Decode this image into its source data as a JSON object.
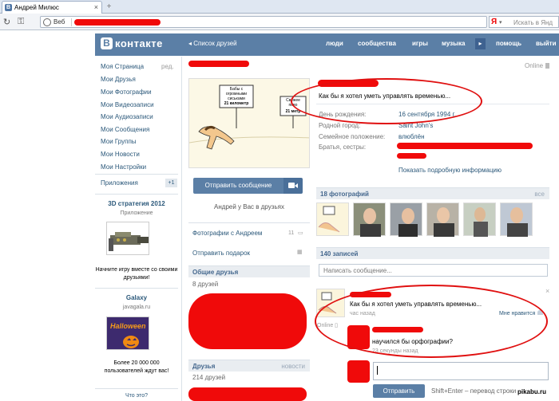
{
  "browser": {
    "tab_title": "Андрей Милюс",
    "tab_close": "×",
    "new_tab": "+",
    "address_label": "Веб",
    "search_placeholder": "Искать в Янд",
    "search_logo": "Я"
  },
  "header": {
    "logo_letter": "В",
    "logo_text": "контакте",
    "friends_list_link": "Список друзей",
    "nav": [
      "люди",
      "сообщества",
      "игры",
      "музыка",
      "помощь",
      "выйти"
    ],
    "brand_color": "#5b7fa6"
  },
  "left_menu": {
    "edit_label": "ред.",
    "items": [
      "Моя Страница",
      "Мои Друзья",
      "Мои Фотографии",
      "Мои Видеозаписи",
      "Мои Аудиозаписи",
      "Мои Сообщения",
      "Мои Группы",
      "Мои Новости",
      "Мои Настройки"
    ],
    "apps_label": "Приложения",
    "apps_count": "+1"
  },
  "ads": [
    {
      "title": "3D стратегия 2012",
      "subtitle": "Приложение",
      "text": "Начните игру вместе со своими друзьями!"
    },
    {
      "title": "Galaxy",
      "subtitle": "javagala.ru",
      "text": "Более 20 000 000 пользователей ждут вас!",
      "image_text": "Halloween"
    }
  ],
  "ads_footer": "Что это?",
  "profile": {
    "online_label": "Online",
    "status_text": "Как бы я хотел уметь управлять временью...",
    "fields": [
      {
        "label": "День рождения:",
        "value": "16 сентября 1994 г."
      },
      {
        "label": "Родной город:",
        "value": "Saint John's"
      },
      {
        "label": "Семейное положение:",
        "value": "влюблён"
      },
      {
        "label": "Братья, сестры:",
        "value": ""
      }
    ],
    "show_full": "Показать подробную информацию",
    "avatar_sign_1": "Бабы с огромными сиськами",
    "avatar_sign_1_km": "21 километр",
    "avatar_sign_2": "Свежее пиво",
    "avatar_sign_2_km": "21 метр"
  },
  "left_column": {
    "send_message": "Отправить сообщение",
    "in_friends": "Андрей у Вас в друзьях",
    "photos_with": "Фотографии с Андреем",
    "photos_with_count": "11",
    "send_gift": "Отправить подарок",
    "mutual_friends": "Общие друзья",
    "mutual_count": "8 друзей",
    "friends": "Друзья",
    "friends_new": "новости",
    "friends_count": "214 друзей"
  },
  "photos": {
    "header": "18 фотографий",
    "all": "все"
  },
  "wall": {
    "header": "140 записей",
    "input_placeholder": "Написать сообщение...",
    "post_text": "Как бы я хотел уметь управлять временью...",
    "post_time": "час назад",
    "like_label": "Мне нравится",
    "close": "×",
    "online_label": "Online",
    "comment_text": "научился бы орфографии?",
    "comment_time": "23 секунды назад",
    "send_button": "Отправить",
    "hint": "Shift+Enter – перевод строки",
    "watermark": "pikabu.ru"
  },
  "colors": {
    "annotation": "#e01010",
    "redaction": "#f00a0a",
    "link": "#2b587a"
  }
}
